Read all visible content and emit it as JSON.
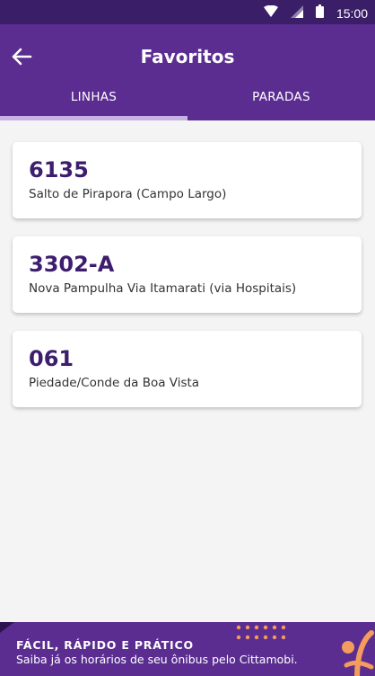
{
  "status_bar": {
    "time": "15:00",
    "icons": [
      "wifi-icon",
      "signal-icon",
      "battery-icon"
    ]
  },
  "app_bar": {
    "title": "Favoritos",
    "back_icon": "arrow-left-icon"
  },
  "tabs": [
    {
      "label": "LINHAS",
      "selected": true
    },
    {
      "label": "PARADAS",
      "selected": false
    }
  ],
  "favorites": [
    {
      "number": "6135",
      "name": "Salto de Pirapora (Campo Largo)"
    },
    {
      "number": "3302-A",
      "name": "Nova Pampulha Via Itamarati (via Hospitais)"
    },
    {
      "number": "061",
      "name": "Piedade/Conde da Boa Vista"
    }
  ],
  "banner": {
    "title": "FÁCIL, RÁPIDO E PRÁTICO",
    "subtitle": "Saiba já os horários de seu ônibus pelo Cittamobi."
  },
  "colors": {
    "status_bar": "#3a1e68",
    "primary": "#5b2d91",
    "line_number": "#3d1d6e",
    "tab_indicator": "#c7b3e3",
    "accent_orange": "#f39c5c",
    "background": "#f4f4f4"
  }
}
